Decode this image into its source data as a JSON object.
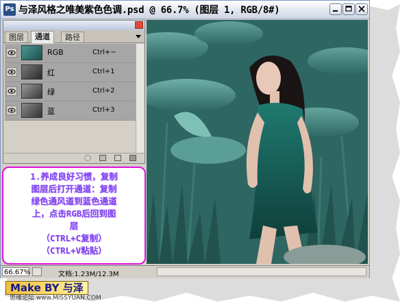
{
  "window": {
    "title": "与泽风格之唯美紫色色调.psd @ 66.7% (图层 1, RGB/8#)",
    "app_icon": "Ps"
  },
  "palette": {
    "tabs": [
      {
        "label": "图层",
        "active": false
      },
      {
        "label": "通道",
        "active": true
      },
      {
        "label": "路径",
        "active": false
      }
    ],
    "channels": [
      {
        "name": "RGB",
        "shortcut": "Ctrl+~",
        "thumb_color": "#3f8a86"
      },
      {
        "name": "红",
        "shortcut": "Ctrl+1",
        "thumb_color": "#4a4a4a"
      },
      {
        "name": "绿",
        "shortcut": "Ctrl+2",
        "thumb_color": "#6a6a6a"
      },
      {
        "name": "蓝",
        "shortcut": "Ctrl+3",
        "thumb_color": "#5a5a5a"
      }
    ]
  },
  "instruction": {
    "lines": [
      "1.养成良好习惯，复制",
      "图层后打开通道：复制",
      "绿色通风道到蓝色通道",
      "上，点击RGB后回到图",
      "层",
      "（CTRL+C复制）",
      "（CTRL+V粘贴）"
    ],
    "color": "#7a3cf0",
    "border_color": "#e010d8"
  },
  "status": {
    "zoom": "66.67%",
    "doc": "文档:1.23M/12.3M"
  },
  "signature": {
    "text": "Make BY 与泽",
    "watermark": "思缘论坛 www.MISSYUAN.COM"
  },
  "colors": {
    "image_tint": "#2f6a66",
    "chrome": "#d4d0c8"
  }
}
